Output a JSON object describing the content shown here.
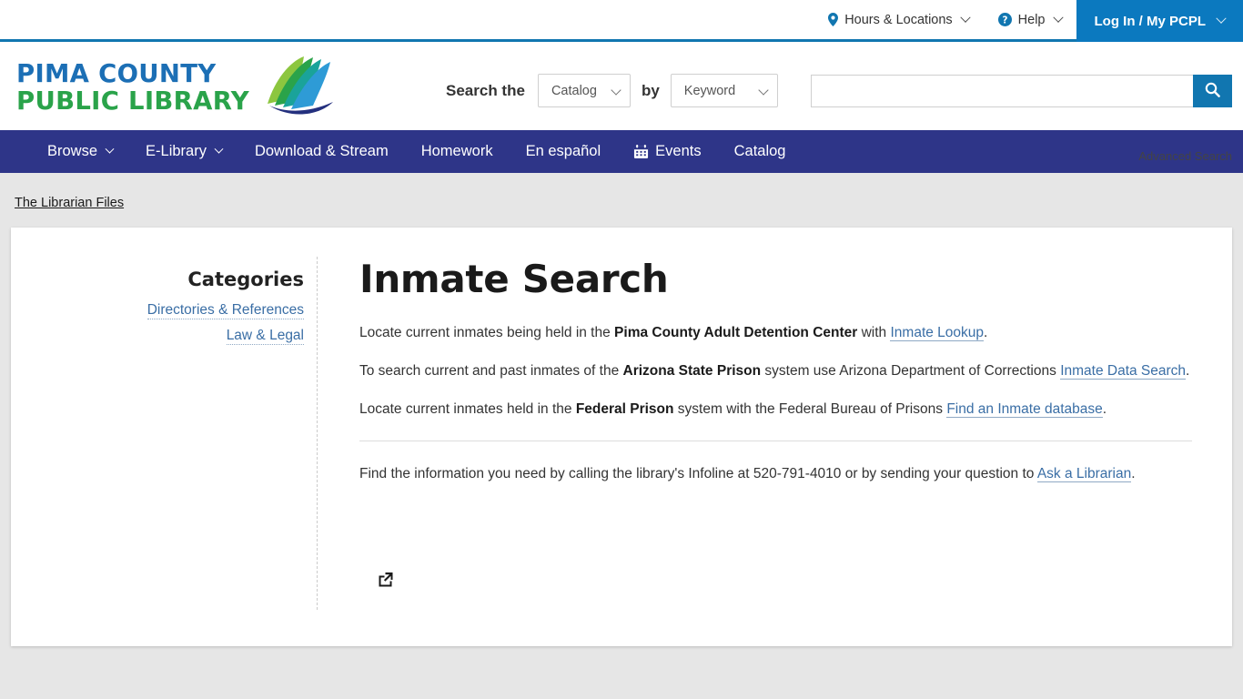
{
  "utility_bar": {
    "hours_locations": "Hours & Locations",
    "help": "Help",
    "login": "Log In / My PCPL"
  },
  "header": {
    "logo_line1": "PIMA COUNTY",
    "logo_line2": "PUBLIC LIBRARY",
    "search_the_label": "Search the",
    "scope_selected": "Catalog",
    "by_label": "by",
    "field_selected": "Keyword",
    "search_value": "",
    "search_placeholder": "",
    "advanced_search": "Advanced Search"
  },
  "nav": {
    "items": [
      {
        "label": "Browse",
        "caret": true,
        "icon": ""
      },
      {
        "label": "E-Library",
        "caret": true,
        "icon": ""
      },
      {
        "label": "Download & Stream",
        "caret": false,
        "icon": ""
      },
      {
        "label": "Homework",
        "caret": false,
        "icon": ""
      },
      {
        "label": "En español",
        "caret": false,
        "icon": ""
      },
      {
        "label": "Events",
        "caret": false,
        "icon": "calendar-icon"
      },
      {
        "label": "Catalog",
        "caret": false,
        "icon": ""
      }
    ]
  },
  "breadcrumb": {
    "label": "The Librarian Files"
  },
  "sidebar": {
    "heading": "Categories",
    "categories": [
      {
        "label": "Directories & References"
      },
      {
        "label": "Law & Legal"
      }
    ]
  },
  "main": {
    "title": "Inmate Search",
    "paragraphs": [
      {
        "parts": [
          {
            "type": "text",
            "text": "Locate current inmates being held in the "
          },
          {
            "type": "bold",
            "text": "Pima County Adult Detention Center"
          },
          {
            "type": "text",
            "text": " with "
          },
          {
            "type": "link",
            "text": "Inmate Lookup"
          },
          {
            "type": "text",
            "text": "."
          }
        ]
      },
      {
        "parts": [
          {
            "type": "text",
            "text": "To search current and past inmates of the "
          },
          {
            "type": "bold",
            "text": "Arizona State Prison"
          },
          {
            "type": "text",
            "text": " system use Arizona Department of Corrections "
          },
          {
            "type": "link",
            "text": "Inmate Data Search"
          },
          {
            "type": "text",
            "text": "."
          }
        ]
      },
      {
        "parts": [
          {
            "type": "text",
            "text": "Locate current inmates held in the "
          },
          {
            "type": "bold",
            "text": "Federal Prison"
          },
          {
            "type": "text",
            "text": " system with the Federal Bureau of Prisons "
          },
          {
            "type": "link",
            "text": "Find an Inmate database"
          },
          {
            "type": "text",
            "text": "."
          }
        ]
      }
    ],
    "footer_paragraph": {
      "parts": [
        {
          "type": "text",
          "text": "Find the information you need by calling the library's Infoline at 520-791-4010 or by sending your question to "
        },
        {
          "type": "link",
          "text": "Ask a Librarian"
        },
        {
          "type": "text",
          "text": "."
        }
      ]
    },
    "share_icon": "share-icon"
  },
  "colors": {
    "nav_blue": "#2e3588",
    "accent_blue": "#1176b0",
    "login_blue": "#0b79bf",
    "link_blue": "#3a6ea5",
    "logo_blue": "#1c6fb5",
    "logo_green": "#2aa34a",
    "page_bg": "#e6e6e6"
  }
}
